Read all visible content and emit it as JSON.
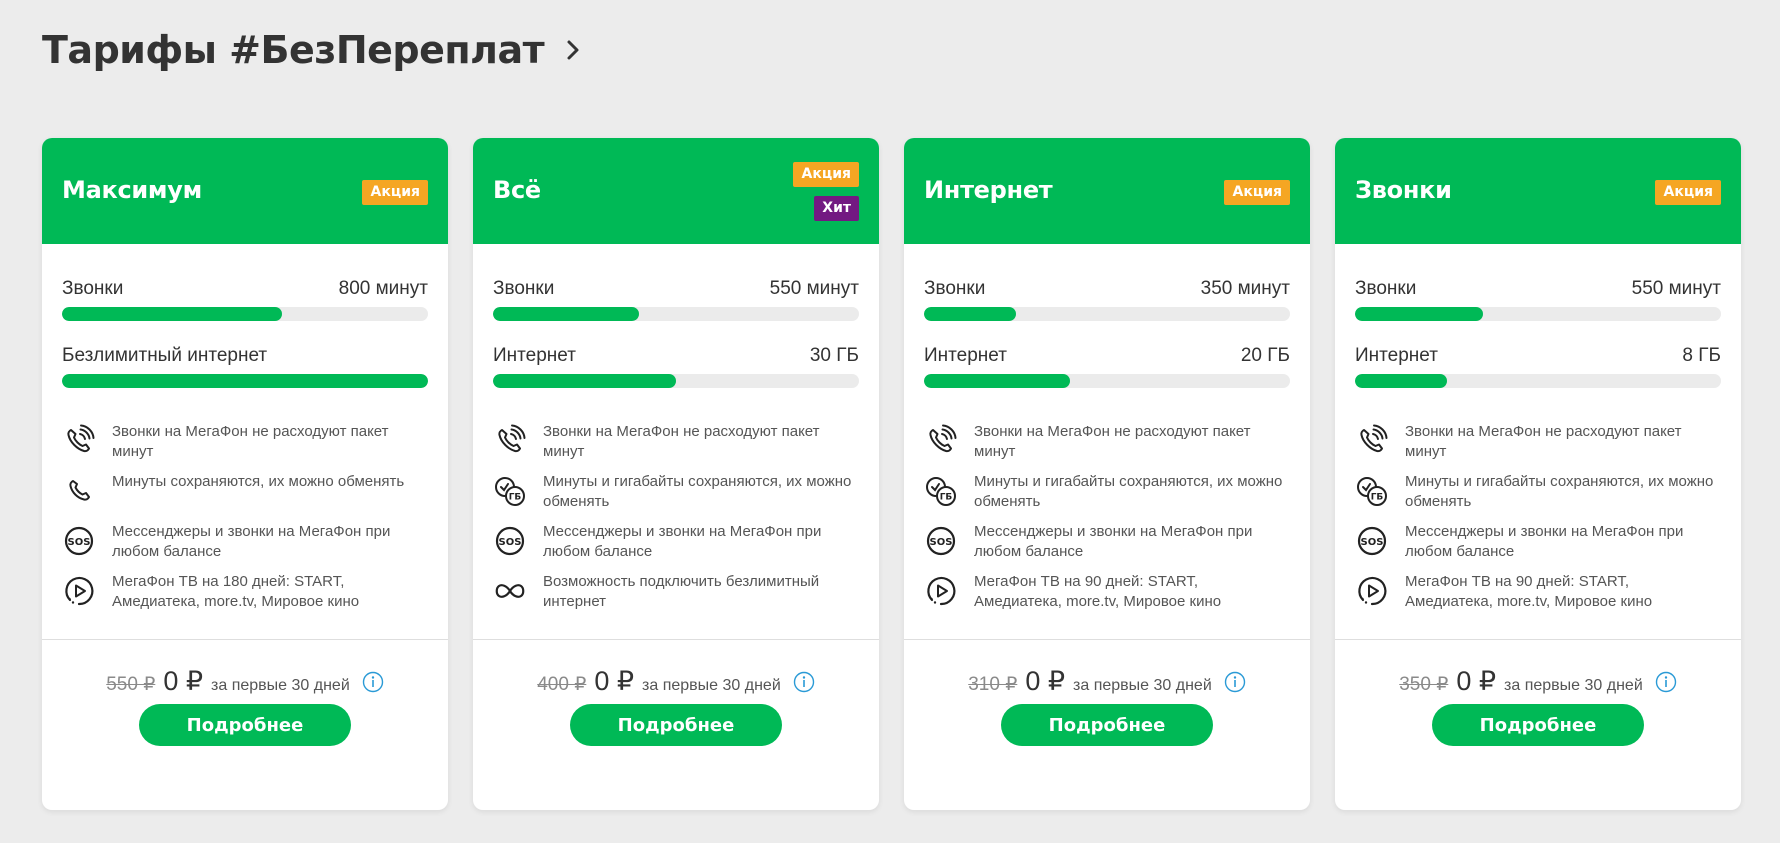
{
  "page": {
    "title": "Тарифы #БезПереплат",
    "title_icon": "chevron-right-icon"
  },
  "colors": {
    "brand_green": "#00b956",
    "promo_badge": "#f5a623",
    "hit_badge": "#731982",
    "background": "#ececec"
  },
  "cards": [
    {
      "name": "Максимум",
      "badges": [
        "Акция"
      ],
      "meters": [
        {
          "label": "Звонки",
          "value": "800 минут",
          "fill": 0.6
        },
        {
          "label": "Безлимитный интернет",
          "value": "",
          "fill": 1.0
        }
      ],
      "features": [
        {
          "icon": "call-waves-icon",
          "text": "Звонки на МегаФон не расходуют пакет минут"
        },
        {
          "icon": "phone-icon",
          "text": "Минуты сохраняются, их можно обменять"
        },
        {
          "icon": "sos-icon",
          "text": "Мессенджеры и звонки на МегаФон при любом балансе"
        },
        {
          "icon": "play-tv-icon",
          "text": "МегаФон ТВ на 180 дней: START, Амедиатека, more.tv, Мировое кино"
        }
      ],
      "old_price": "550 ₽",
      "new_price": "0 ₽",
      "price_note": "за первые 30 дней",
      "button": "Подробнее"
    },
    {
      "name": "Всё",
      "badges": [
        "Акция",
        "Хит"
      ],
      "meters": [
        {
          "label": "Звонки",
          "value": "550 минут",
          "fill": 0.4
        },
        {
          "label": "Интернет",
          "value": "30 ГБ",
          "fill": 0.5
        }
      ],
      "features": [
        {
          "icon": "call-waves-icon",
          "text": "Звонки на МегаФон не расходуют пакет минут"
        },
        {
          "icon": "exchange-gb-icon",
          "text": "Минуты и гигабайты сохраняются, их можно обменять"
        },
        {
          "icon": "sos-icon",
          "text": "Мессенджеры и звонки на МегаФон при любом балансе"
        },
        {
          "icon": "infinity-icon",
          "text": "Возможность подключить безлимитный интернет"
        }
      ],
      "old_price": "400 ₽",
      "new_price": "0 ₽",
      "price_note": "за первые 30 дней",
      "button": "Подробнее"
    },
    {
      "name": "Интернет",
      "badges": [
        "Акция"
      ],
      "meters": [
        {
          "label": "Звонки",
          "value": "350 минут",
          "fill": 0.25
        },
        {
          "label": "Интернет",
          "value": "20 ГБ",
          "fill": 0.4
        }
      ],
      "features": [
        {
          "icon": "call-waves-icon",
          "text": "Звонки на МегаФон не расходуют пакет минут"
        },
        {
          "icon": "exchange-gb-icon",
          "text": "Минуты и гигабайты сохраняются, их можно обменять"
        },
        {
          "icon": "sos-icon",
          "text": "Мессенджеры и звонки на МегаФон при любом балансе"
        },
        {
          "icon": "play-tv-icon",
          "text": "МегаФон ТВ на 90 дней: START, Амедиатека, more.tv, Мировое кино"
        }
      ],
      "old_price": "310 ₽",
      "new_price": "0 ₽",
      "price_note": "за первые 30 дней",
      "button": "Подробнее"
    },
    {
      "name": "Звонки",
      "badges": [
        "Акция"
      ],
      "meters": [
        {
          "label": "Звонки",
          "value": "550 минут",
          "fill": 0.35
        },
        {
          "label": "Интернет",
          "value": "8 ГБ",
          "fill": 0.25
        }
      ],
      "features": [
        {
          "icon": "call-waves-icon",
          "text": "Звонки на МегаФон не расходуют пакет минут"
        },
        {
          "icon": "exchange-gb-icon",
          "text": "Минуты и гигабайты сохраняются, их можно обменять"
        },
        {
          "icon": "sos-icon",
          "text": "Мессенджеры и звонки на МегаФон при любом балансе"
        },
        {
          "icon": "play-tv-icon",
          "text": "МегаФон ТВ на 90 дней: START, Амедиатека, more.tv, Мировое кино"
        }
      ],
      "old_price": "350 ₽",
      "new_price": "0 ₽",
      "price_note": "за первые 30 дней",
      "button": "Подробнее"
    }
  ]
}
